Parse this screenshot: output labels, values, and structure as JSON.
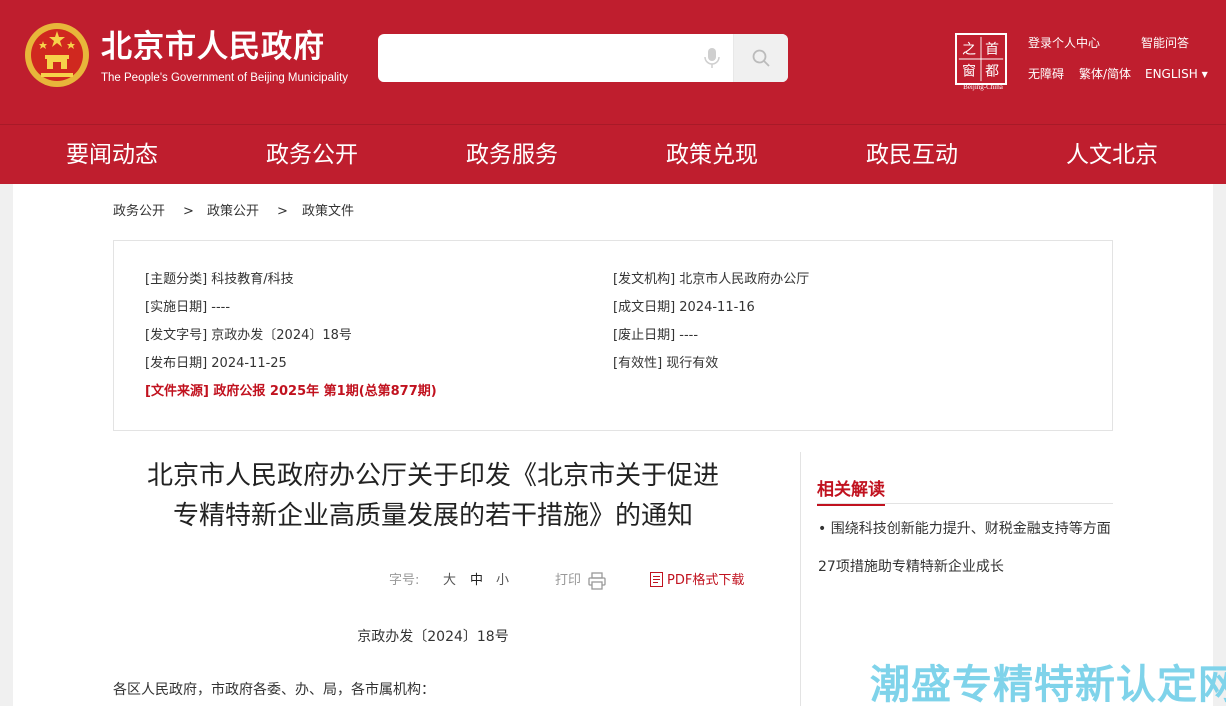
{
  "header": {
    "title_cn": "北京市人民政府",
    "title_en": "The People's Government of Beijing Municipality",
    "search": {
      "placeholder": ""
    },
    "seal": {
      "chars": [
        "首",
        "都",
        "之",
        "窗"
      ],
      "caption": "Beijing-China"
    },
    "links": {
      "login": "登录个人中心",
      "qa": "智能问答",
      "accessibility": "无障碍",
      "script_switch": "繁体/简体",
      "english": "ENGLISH"
    }
  },
  "nav": [
    "要闻动态",
    "政务公开",
    "政务服务",
    "政策兑现",
    "政民互动",
    "人文北京"
  ],
  "breadcrumb": {
    "items": [
      "政务公开",
      "政策公开",
      "政策文件"
    ],
    "separator": ">"
  },
  "meta": {
    "topic": "[主题分类] 科技教育/科技",
    "issuer": "[发文机构] 北京市人民政府办公厅",
    "effective_date": "[实施日期] ----",
    "created_date": "[成文日期] 2024-11-16",
    "doc_no": "[发文字号] 京政办发〔2024〕18号",
    "abolish_date": "[废止日期] ----",
    "publish_date": "[发布日期] 2024-11-25",
    "validity": "[有效性] 现行有效",
    "source": "[文件来源] 政府公报 2025年 第1期(总第877期)"
  },
  "document": {
    "title_line1": "北京市人民政府办公厅关于印发《北京市关于促进",
    "title_line2": "专精特新企业高质量发展的若干措施》的通知",
    "font_label": "字号:",
    "size_large": "大",
    "size_medium": "中",
    "size_small": "小",
    "print": "打印",
    "pdf": "PDF格式下载",
    "doc_no": "京政办发〔2024〕18号",
    "greeting": "各区人民政府，市政府各委、办、局，各市属机构："
  },
  "related": {
    "title": "相关解读",
    "items": [
      "• 围绕科技创新能力提升、财税金融支持等方面 27项措施助专精特新企业成长"
    ]
  },
  "watermark": "潮盛专精特新认定网",
  "colors": {
    "brand_red": "#bf1e2e",
    "link_red": "#c1121f",
    "watermark": "#7fd3ea"
  }
}
